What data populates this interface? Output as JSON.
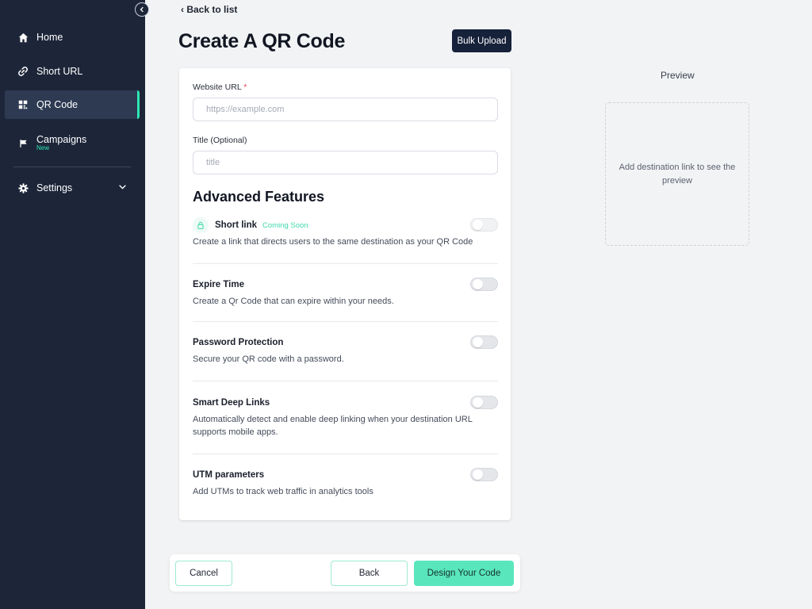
{
  "sidebar": {
    "items": [
      {
        "label": "Home",
        "icon": "home-icon"
      },
      {
        "label": "Short URL",
        "icon": "link-icon"
      },
      {
        "label": "QR Code",
        "icon": "qr-code-icon"
      },
      {
        "label": "Campaigns",
        "badge": "New",
        "icon": "flag-icon"
      },
      {
        "label": "Settings",
        "icon": "gear-icon"
      }
    ],
    "active": "QR Code"
  },
  "header": {
    "back_label": "Back to list",
    "title": "Create A QR Code",
    "bulk_upload_label": "Bulk Upload"
  },
  "form": {
    "url_label": "Website URL",
    "url_required_mark": "*",
    "url_placeholder": "https://example.com",
    "title_label": "Title (Optional)",
    "title_placeholder": "title",
    "advanced_title": "Advanced Features",
    "features": [
      {
        "title": "Short link",
        "tag": "Coming Soon",
        "desc": "Create a link that directs users to the same destination as your QR Code",
        "enabled": false
      },
      {
        "title": "Expire Time",
        "desc": "Create a Qr Code that can expire within your needs.",
        "enabled": false
      },
      {
        "title": "Password Protection",
        "desc": "Secure your QR code with a password.",
        "enabled": false
      },
      {
        "title": "Smart Deep Links",
        "desc": "Automatically detect and enable deep linking when your destination URL supports mobile apps.",
        "enabled": false
      },
      {
        "title": "UTM parameters",
        "desc": "Add UTMs to track web traffic in analytics tools",
        "enabled": false
      }
    ]
  },
  "preview": {
    "label": "Preview",
    "empty_text": "Add destination link to see the preview"
  },
  "footer": {
    "cancel_label": "Cancel",
    "back_label": "Back",
    "design_label": "Design Your Code"
  },
  "colors": {
    "sidebar_bg": "#1d2639",
    "accent": "#2ee6b4",
    "primary_button": "#59e6bd",
    "dark_button": "#16213a"
  }
}
